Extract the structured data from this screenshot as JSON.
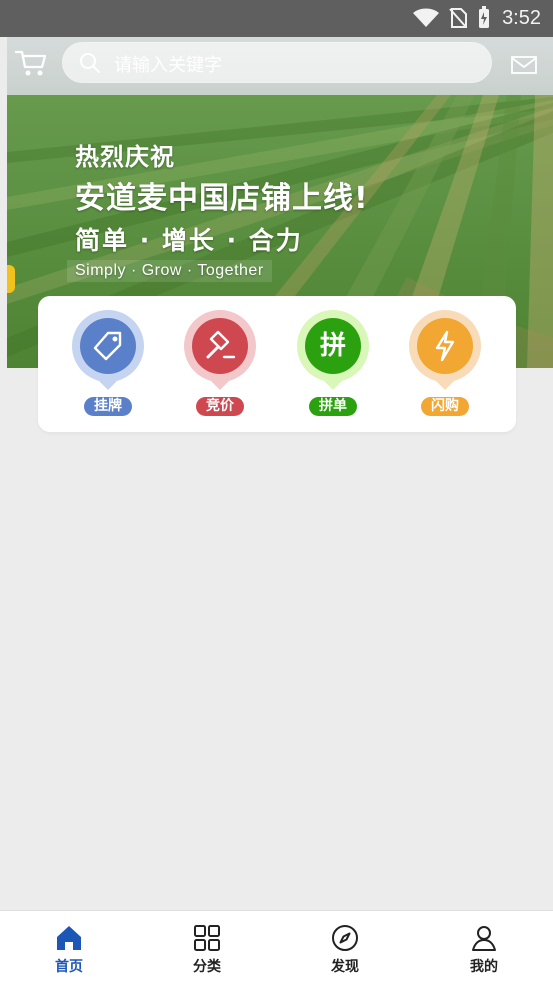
{
  "status": {
    "time": "3:52"
  },
  "search": {
    "placeholder": "请输入关键字"
  },
  "banner": {
    "line1": "热烈庆祝",
    "line2": "安道麦中国店铺上线!",
    "line3": "简单 · 增长 · 合力",
    "line4": "Simply · Grow · Together"
  },
  "quick_actions": [
    {
      "label": "挂牌",
      "icon": "tag-icon",
      "ring_color": "#c5d4f0",
      "core_color": "#5a80c9",
      "label_color": "#5a80c9"
    },
    {
      "label": "竞价",
      "icon": "gavel-icon",
      "ring_color": "#f2c8cb",
      "core_color": "#cf4850",
      "label_color": "#cf4850"
    },
    {
      "label": "拼单",
      "icon": "pin-dan-icon",
      "ring_color": "#d8f7b8",
      "core_color": "#2ca10f",
      "label_color": "#2ca10f",
      "glyph": "拼"
    },
    {
      "label": "闪购",
      "icon": "lightning-icon",
      "ring_color": "#f8dcb9",
      "core_color": "#f1a732",
      "label_color": "#f1a732"
    }
  ],
  "bottom_nav": [
    {
      "label": "首页",
      "icon": "home-icon",
      "active": true
    },
    {
      "label": "分类",
      "icon": "category-grid-icon",
      "active": false
    },
    {
      "label": "发现",
      "icon": "compass-icon",
      "active": false
    },
    {
      "label": "我的",
      "icon": "user-icon",
      "active": false
    }
  ],
  "colors": {
    "active_nav": "#1c57b8",
    "background": "#ececec",
    "status_bar": "#5f5f5f"
  }
}
